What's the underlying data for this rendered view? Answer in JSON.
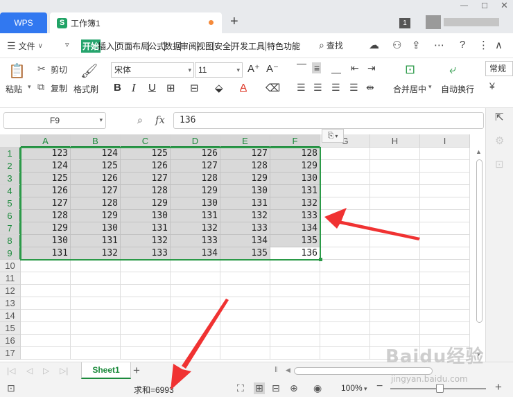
{
  "title_bar": {
    "app_tab": "WPS",
    "doc_icon": "S",
    "doc_title": "工作簿1",
    "badge": "1"
  },
  "menu": {
    "file": "文件",
    "tabs": [
      "开始",
      "插入",
      "页面布局",
      "公式",
      "数据",
      "审阅",
      "视图",
      "安全",
      "开发工具",
      "特色功能"
    ],
    "search": "查找"
  },
  "ribbon": {
    "paste": "粘贴",
    "cut": "剪切",
    "copy": "复制",
    "format_painter": "格式刷",
    "font_name": "宋体",
    "font_size": "11",
    "merge_center": "合并居中",
    "wrap_text": "自动换行",
    "style_box": "常规"
  },
  "formula_bar": {
    "name_box": "F9",
    "fx": "fx",
    "value": "136"
  },
  "grid": {
    "columns": [
      "A",
      "B",
      "C",
      "D",
      "E",
      "F",
      "G",
      "H",
      "I"
    ],
    "rows": [
      "1",
      "2",
      "3",
      "4",
      "5",
      "6",
      "7",
      "8",
      "9",
      "10",
      "11",
      "12",
      "13",
      "14",
      "15",
      "16",
      "17"
    ],
    "values": [
      [
        "123",
        "124",
        "125",
        "126",
        "127",
        "128"
      ],
      [
        "124",
        "125",
        "126",
        "127",
        "128",
        "129"
      ],
      [
        "125",
        "126",
        "127",
        "128",
        "129",
        "130"
      ],
      [
        "126",
        "127",
        "128",
        "129",
        "130",
        "131"
      ],
      [
        "127",
        "128",
        "129",
        "130",
        "131",
        "132"
      ],
      [
        "128",
        "129",
        "130",
        "131",
        "132",
        "133"
      ],
      [
        "129",
        "130",
        "131",
        "132",
        "133",
        "134"
      ],
      [
        "130",
        "131",
        "132",
        "133",
        "134",
        "135"
      ],
      [
        "131",
        "132",
        "133",
        "134",
        "135",
        "136"
      ]
    ],
    "active_cell": "F9",
    "selection": "A1:F9"
  },
  "sheets": {
    "tabs": [
      "Sheet1"
    ]
  },
  "status": {
    "sum": "求和=6993",
    "zoom": "100%"
  },
  "colors": {
    "accent_green": "#2b9a48",
    "wps_blue": "#3178f0",
    "annotation_red": "#f03232"
  },
  "watermark": {
    "brand": "Baidu经验",
    "url": "jingyan.baidu.com"
  }
}
